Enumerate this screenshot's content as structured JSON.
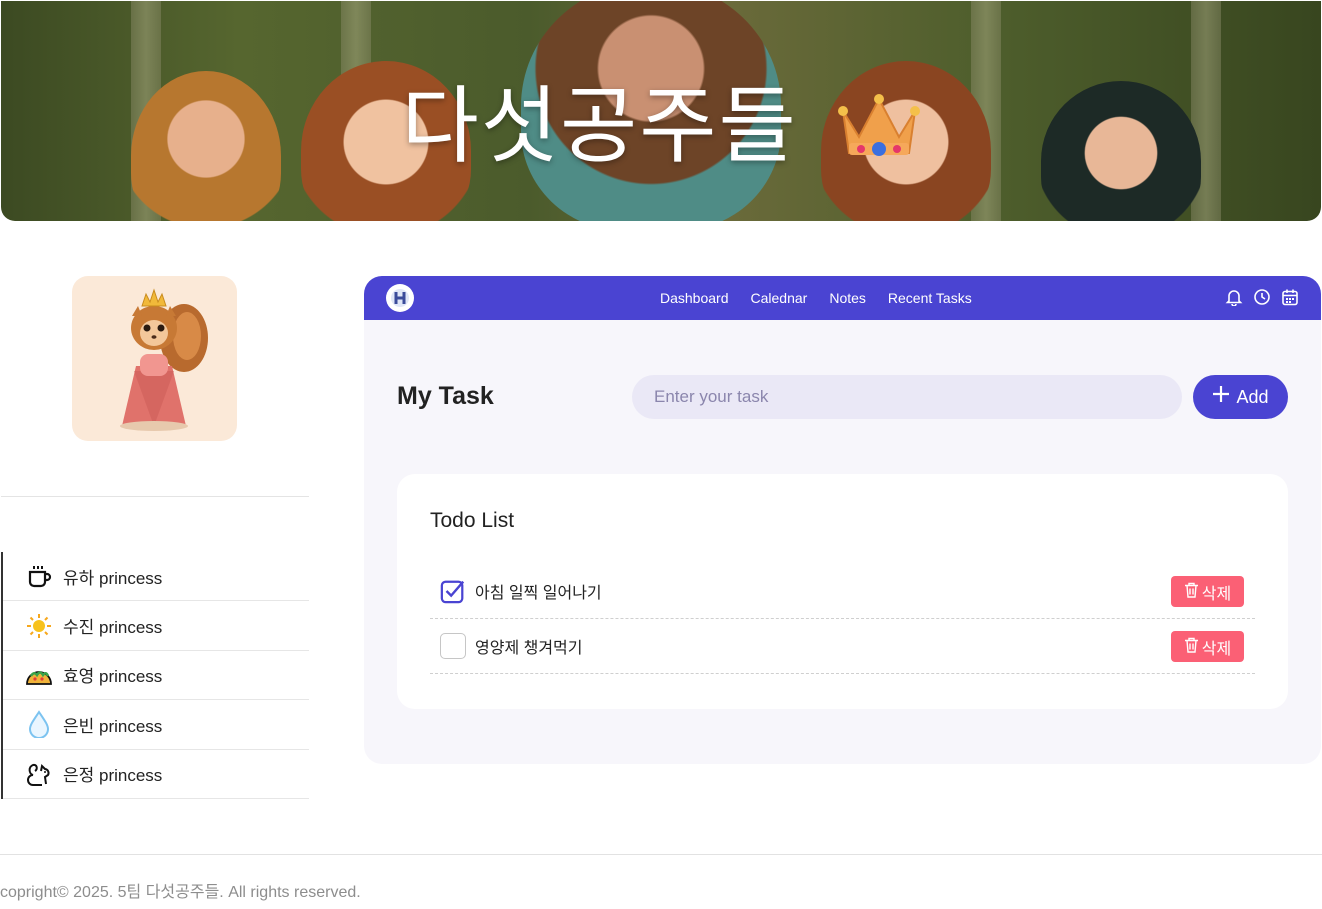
{
  "banner": {
    "title": "다섯공주들",
    "title_emoji": "crown"
  },
  "sidebar": {
    "avatar": "princess-squirrel-avatar",
    "items": [
      {
        "label": "유하 princess",
        "icon": "coffee-cup-icon"
      },
      {
        "label": "수진 princess",
        "icon": "sun-icon"
      },
      {
        "label": "효영 princess",
        "icon": "taco-icon"
      },
      {
        "label": "은빈 princess",
        "icon": "water-drop-icon"
      },
      {
        "label": "은정 princess",
        "icon": "squirrel-icon"
      }
    ]
  },
  "navbar": {
    "links": [
      "Dashboard",
      "Calednar",
      "Notes",
      "Recent Tasks"
    ],
    "icons": [
      "bell-icon",
      "clock-icon",
      "calendar-icon"
    ],
    "accent": "#4a44d2"
  },
  "main": {
    "heading": "My Task",
    "input": {
      "placeholder": "Enter your task",
      "value": ""
    },
    "add_label": "Add"
  },
  "todo": {
    "title": "Todo List",
    "items": [
      {
        "text": "아침 일찍 일어나기",
        "checked": true,
        "delete_label": "삭제"
      },
      {
        "text": "영양제 챙겨먹기",
        "checked": false,
        "delete_label": "삭제"
      }
    ],
    "delete_color": "#fb6075"
  },
  "footer": {
    "text": "copright© 2025. 5팀 다섯공주들. All rights reserved."
  }
}
